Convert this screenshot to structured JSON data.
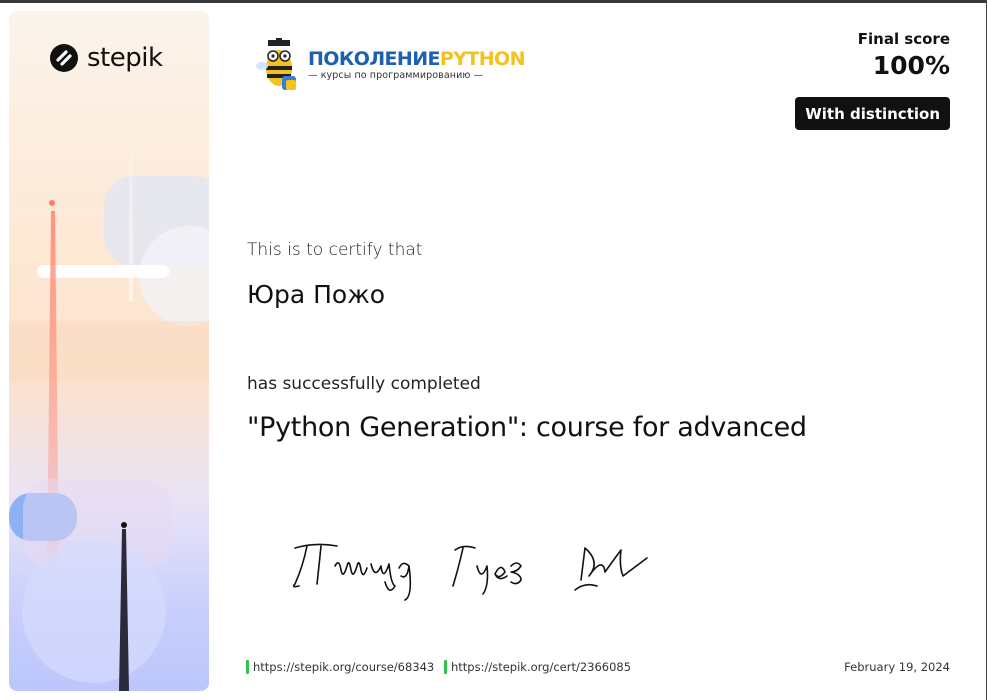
{
  "brand": {
    "name": "stepik",
    "icon": "stepik-logo-icon"
  },
  "course_logo": {
    "title_part1": "ПОКОЛЕНИЕ",
    "title_part2": "PYTHON",
    "subtitle": "— курсы по программированию —",
    "icon": "bee-mascot-icon"
  },
  "score": {
    "label": "Final score",
    "value": "100%",
    "badge": "With distinction"
  },
  "certificate": {
    "intro": "This is to certify that",
    "recipient": "Юра Пожо",
    "completed": "has successfully completed",
    "course": "\"Python Generation\": course for advanced"
  },
  "signature": {
    "text": "Тимур Гуев"
  },
  "footer": {
    "course_link": "https://stepik.org/course/68343",
    "cert_link": "https://stepik.org/cert/2366085",
    "date": "February 19, 2024"
  },
  "colors": {
    "accent_green": "#32c24d",
    "badge_bg": "#111111",
    "logo_blue": "#1d5fb0",
    "logo_yellow": "#f4c21f"
  }
}
